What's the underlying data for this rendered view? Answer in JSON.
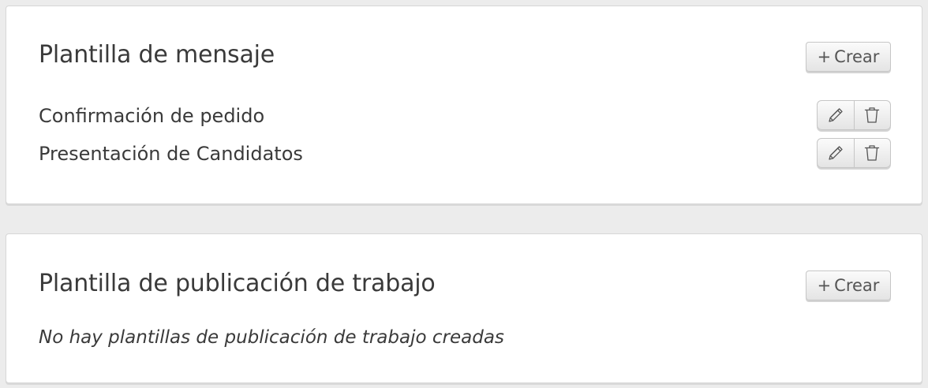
{
  "message_templates": {
    "title": "Plantilla de mensaje",
    "create_button": {
      "plus": "+",
      "label": "Crear"
    },
    "items": [
      {
        "name": "Confirmación de pedido",
        "edit_icon": "pencil-icon",
        "delete_icon": "trash-icon"
      },
      {
        "name": "Presentación de Candidatos",
        "edit_icon": "pencil-icon",
        "delete_icon": "trash-icon"
      }
    ]
  },
  "job_templates": {
    "title": "Plantilla de publicación de trabajo",
    "create_button": {
      "plus": "+",
      "label": "Crear"
    },
    "empty_message": "No hay plantillas de publicación de trabajo creadas"
  },
  "colors": {
    "page_background": "#ececec",
    "panel_background": "#ffffff",
    "text": "#3a3a3a",
    "button_border": "#c6c6c6"
  }
}
